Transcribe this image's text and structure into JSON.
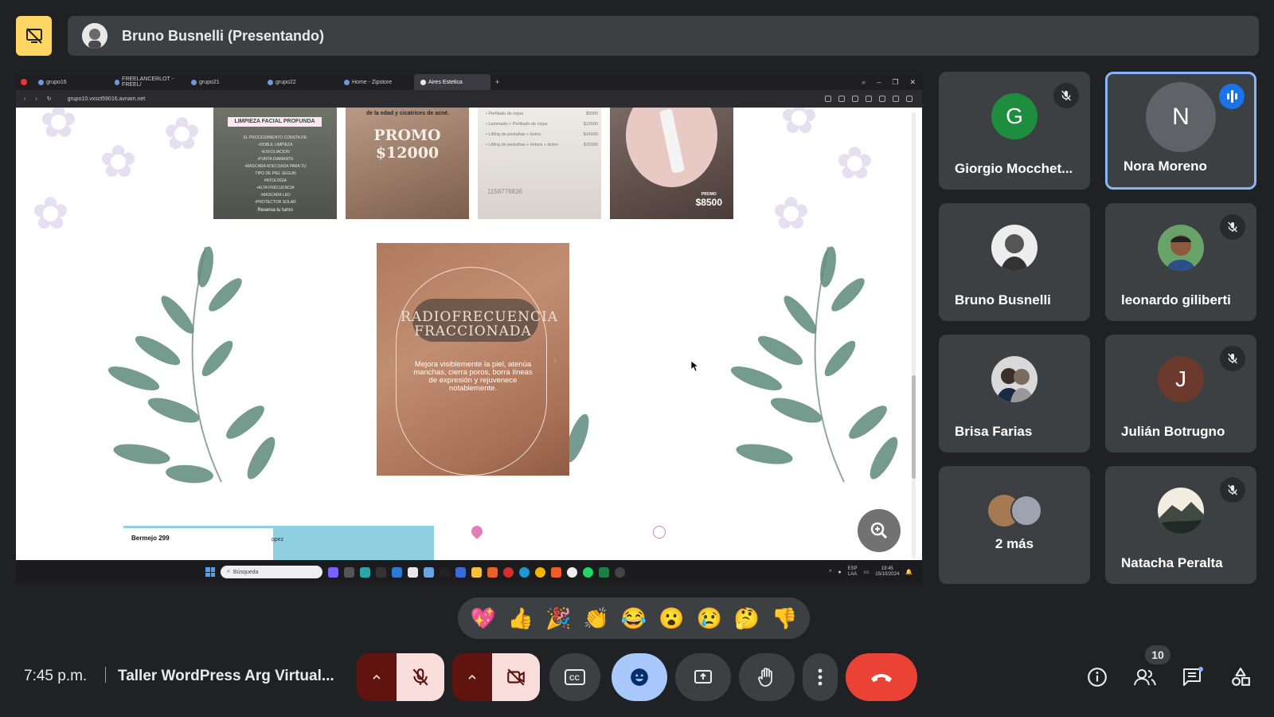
{
  "presenter": {
    "name": "Bruno Busnelli (Presentando)"
  },
  "browser": {
    "tabs": [
      "grupo16",
      "FREELANCERLOT - FREEL/",
      "grupo21",
      "grupo22",
      "Home - Zipstore",
      "Aires Estetica"
    ],
    "url": "grupo10.vxsct59016.avnam.net"
  },
  "website": {
    "promo1": {
      "band": "LIMPIEZA FACIAL PROFUNDA",
      "list": [
        "EL PROCEDIMIENTO CONSTA DE:",
        "•DOBLE LIMPIEZA",
        "•EXFOLIACION",
        "•PUNTA DIAMANTE",
        "•MASCARA ADECUADA PARA TU",
        "TIPO DE PIEL SEGUN",
        "PATOLOGIA",
        "•ALTA FRECUENCIA",
        "•MASCARA LED",
        "•PROTECTOR SOLAR"
      ],
      "cta": "Reserva tu turno"
    },
    "promo2": {
      "top": "de la edad y cicatrices de acné.",
      "big1": "PROMO",
      "big2": "$12000"
    },
    "promo3": {
      "lines": [
        {
          "label": "• Perfilado de cejas",
          "price": "$9000"
        },
        {
          "label": "• Laminado + Perfilado de cejas",
          "price": "$12500"
        },
        {
          "label": "• Lifting de pestañas + botox",
          "price": "$14000"
        },
        {
          "label": "• Lifting de pestañas + tintura + botox",
          "price": "$15000"
        }
      ],
      "phone": "1158776836"
    },
    "promo4": {
      "label": "PROMO",
      "price": "$8500"
    },
    "featured": {
      "heading": "RADIOFRECUENCIA FRACCIONADA",
      "body": "Mejora visiblemente la piel, atenúa manchas, cierra poros, borra líneas de expresión y rejuvenece notablemente."
    },
    "map_card": {
      "title": "Bermejo 299",
      "side": "opez"
    }
  },
  "taskbar": {
    "search_placeholder": "Búsqueda",
    "lang_line1": "ESP",
    "lang_line2": "LAA",
    "time": "19:45",
    "date": "15/10/2024"
  },
  "participants": [
    {
      "name": "Giorgio Mocchet...",
      "initial": "G",
      "color": "#1e8e3e",
      "muted": true
    },
    {
      "name": "Nora Moreno",
      "initial": "N",
      "color": "#5f6368",
      "muted": false,
      "speaking": true
    },
    {
      "name": "Bruno Busnelli",
      "muted": false
    },
    {
      "name": "leonardo giliberti",
      "muted": true
    },
    {
      "name": "Brisa Farias",
      "muted": false
    },
    {
      "name": "Julián Botrugno",
      "initial": "J",
      "color": "#7b3f2f",
      "muted": true
    },
    {
      "name": "2 más"
    },
    {
      "name": "Natacha Peralta",
      "muted": true
    }
  ],
  "reactions": [
    "💖",
    "👍",
    "🎉",
    "👏",
    "😂",
    "😮",
    "😢",
    "🤔",
    "👎"
  ],
  "meeting": {
    "time": "7:45 p.m.",
    "title": "Taller WordPress Arg Virtual...",
    "participant_count": "10"
  },
  "colors": {
    "background": "#202124",
    "tile": "#3c4043",
    "accent": "#8ab4f8",
    "danger": "#ea4335",
    "presenting": "#fdd663"
  }
}
